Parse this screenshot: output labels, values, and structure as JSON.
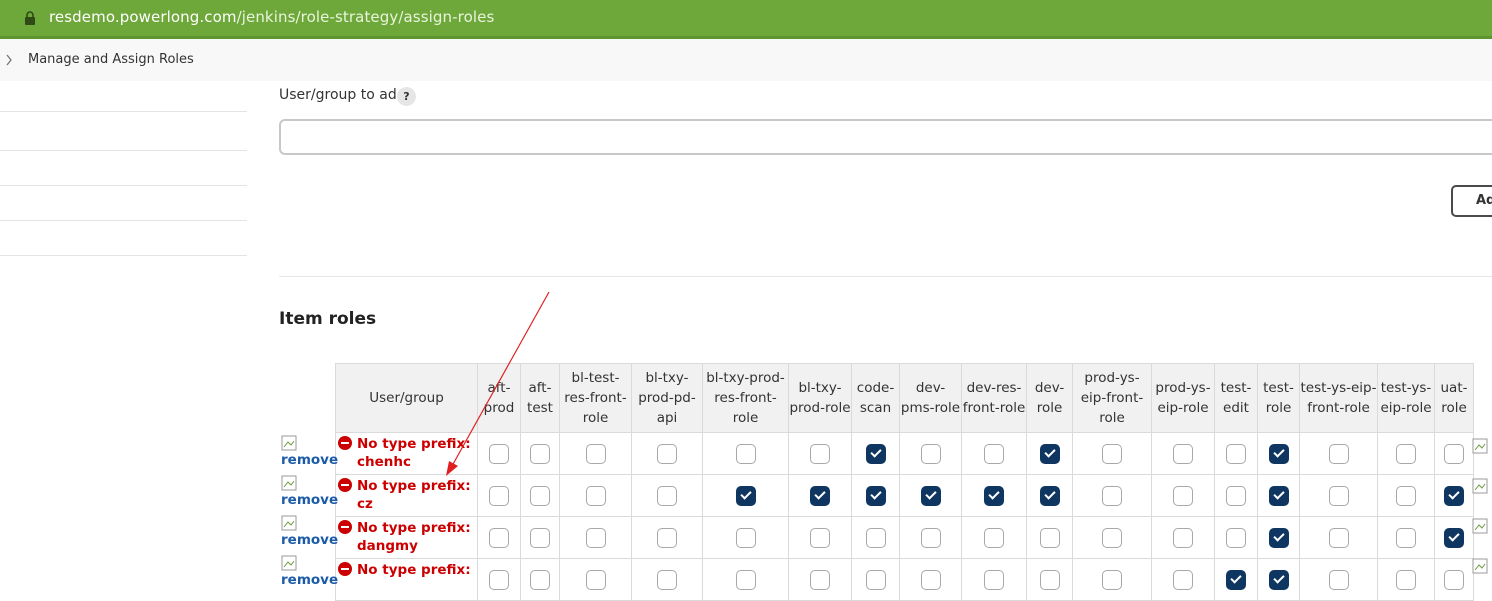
{
  "browser": {
    "url_host": "resdemo.powerlong.com",
    "url_path": "/jenkins/role-strategy/assign-roles"
  },
  "breadcrumb": {
    "label": "Manage and Assign Roles"
  },
  "form": {
    "field_label": "User/group to add",
    "help_label": "?",
    "input_value": "",
    "add_button_label": "Add"
  },
  "item_roles": {
    "title": "Item roles",
    "remove_label": "remove",
    "user_header": "User/group",
    "columns": [
      "aft-prod",
      "aft-test",
      "bl-test-res-front-role",
      "bl-txy-prod-pd-api",
      "bl-txy-prod-res-front-role",
      "bl-txy-prod-role",
      "code-scan",
      "dev-pms-role",
      "dev-res-front-role",
      "dev-role",
      "prod-ys-eip-front-role",
      "prod-ys-eip-role",
      "test-edit",
      "test-role",
      "test-ys-eip-front-role",
      "test-ys-eip-role",
      "uat-role"
    ],
    "rows": [
      {
        "user": "No type prefix: chenhc",
        "checked": [
          false,
          false,
          false,
          false,
          false,
          false,
          true,
          false,
          false,
          true,
          false,
          false,
          false,
          true,
          false,
          false,
          false
        ]
      },
      {
        "user": "No type prefix: cz",
        "checked": [
          false,
          false,
          false,
          false,
          true,
          true,
          true,
          true,
          true,
          true,
          false,
          false,
          false,
          true,
          false,
          false,
          true
        ]
      },
      {
        "user": "No type prefix: dangmy",
        "checked": [
          false,
          false,
          false,
          false,
          false,
          false,
          false,
          false,
          false,
          false,
          false,
          false,
          false,
          true,
          false,
          false,
          true
        ]
      },
      {
        "user": "No type prefix: ",
        "checked": [
          false,
          false,
          false,
          false,
          false,
          false,
          false,
          false,
          false,
          false,
          false,
          false,
          true,
          true,
          false,
          false,
          false
        ]
      }
    ]
  },
  "colors": {
    "url_bar": "#6fa83a",
    "checked": "#0f3660",
    "warning_text": "#cc0000",
    "link": "#1a5aa8",
    "annotation_arrow": "#e02020"
  }
}
